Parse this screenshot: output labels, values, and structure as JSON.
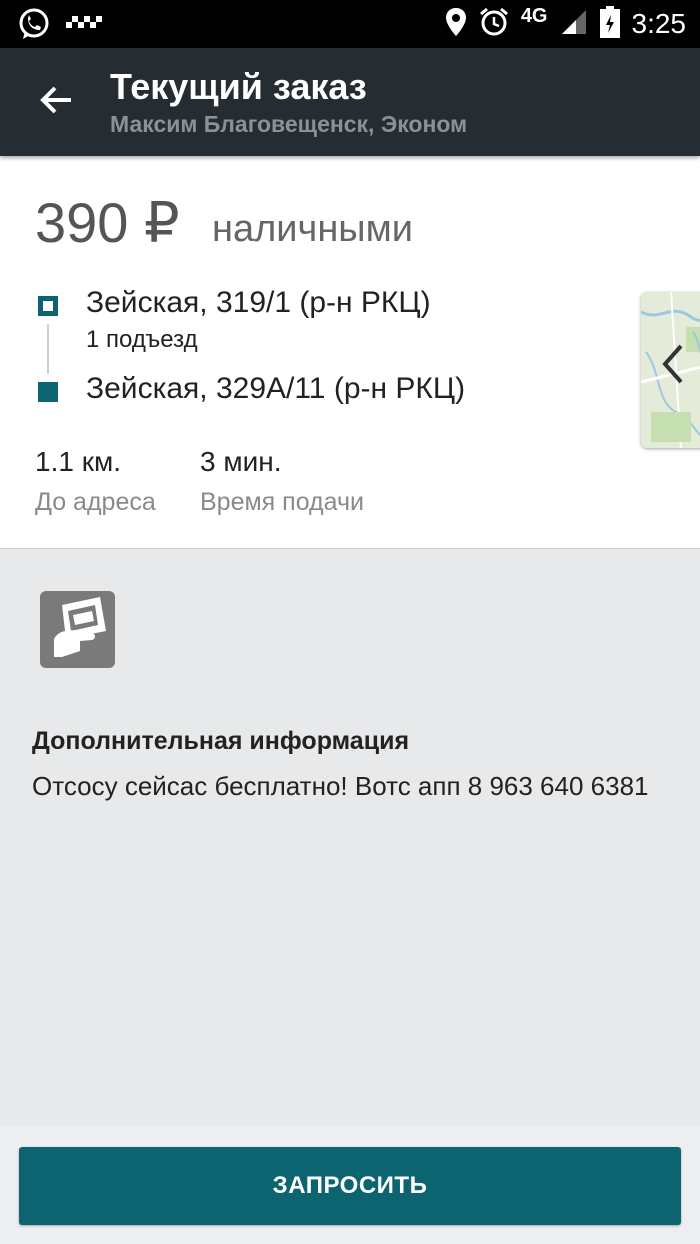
{
  "status_bar": {
    "network": "4G",
    "time": "3:25",
    "icons": [
      "whatsapp-icon",
      "taxi-icon",
      "location-icon",
      "alarm-icon",
      "signal-icon",
      "battery-icon"
    ]
  },
  "app_bar": {
    "title": "Текущий заказ",
    "subtitle": "Максим Благовещенск, Эконом"
  },
  "order": {
    "price": "390 ₽",
    "payment_method": "наличными",
    "from_address": "Зейская, 319/1 (р-н РКЦ)",
    "from_entrance": "1 подъезд",
    "to_address": "Зейская, 329А/11 (р-н РКЦ)",
    "distance_value": "1.1 км.",
    "distance_label": "До адреса",
    "time_value": "3 мин.",
    "time_label": "Время подачи"
  },
  "info": {
    "title": "Дополнительная информация",
    "text": "Отсосу сейсас бесплатно! Вотс апп 8 963 640 6381"
  },
  "actions": {
    "request_label": "ЗАПРОСИТЬ"
  },
  "colors": {
    "accent": "#0c6470",
    "app_bar": "#252d33"
  }
}
